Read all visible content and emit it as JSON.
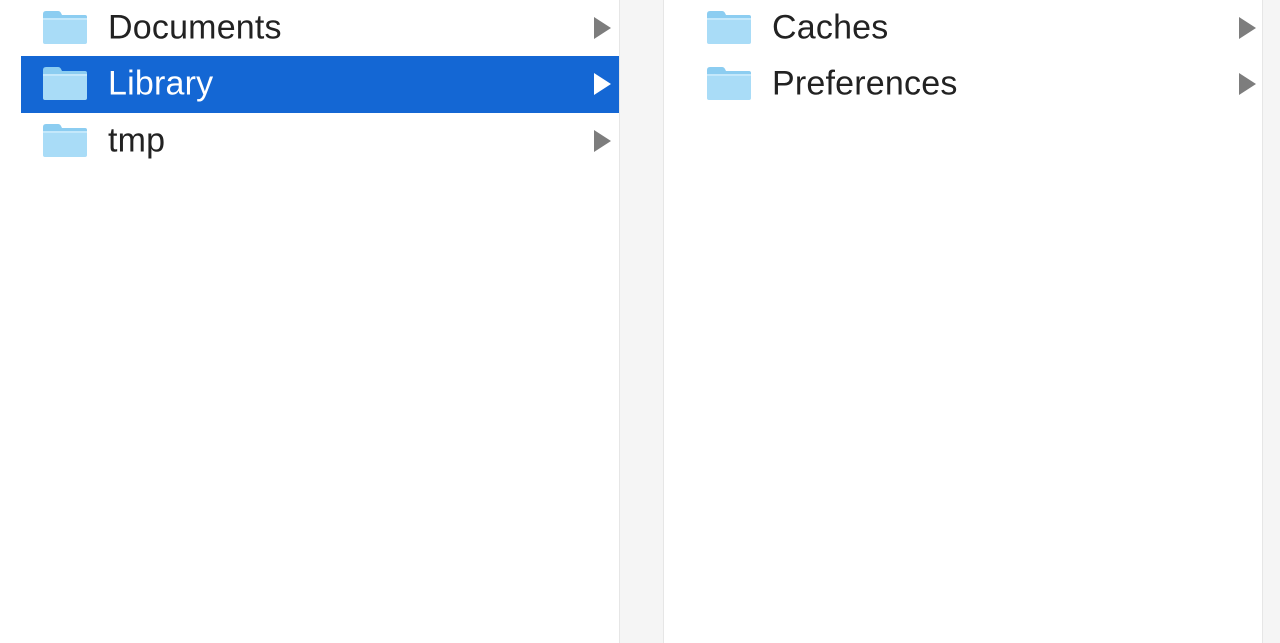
{
  "columns": [
    {
      "items": [
        {
          "label": "Documents",
          "icon": "folder-icon",
          "selected": false
        },
        {
          "label": "Library",
          "icon": "folder-icon",
          "selected": true
        },
        {
          "label": "tmp",
          "icon": "folder-icon",
          "selected": false
        }
      ]
    },
    {
      "items": [
        {
          "label": "Caches",
          "icon": "folder-icon",
          "selected": false
        },
        {
          "label": "Preferences",
          "icon": "folder-icon",
          "selected": false
        }
      ]
    }
  ],
  "colors": {
    "selection": "#1467d4",
    "folder_body": "#a9dcf7",
    "folder_tab": "#8ccdf1",
    "text": "#222222",
    "chevron": "#7d7d7d"
  }
}
